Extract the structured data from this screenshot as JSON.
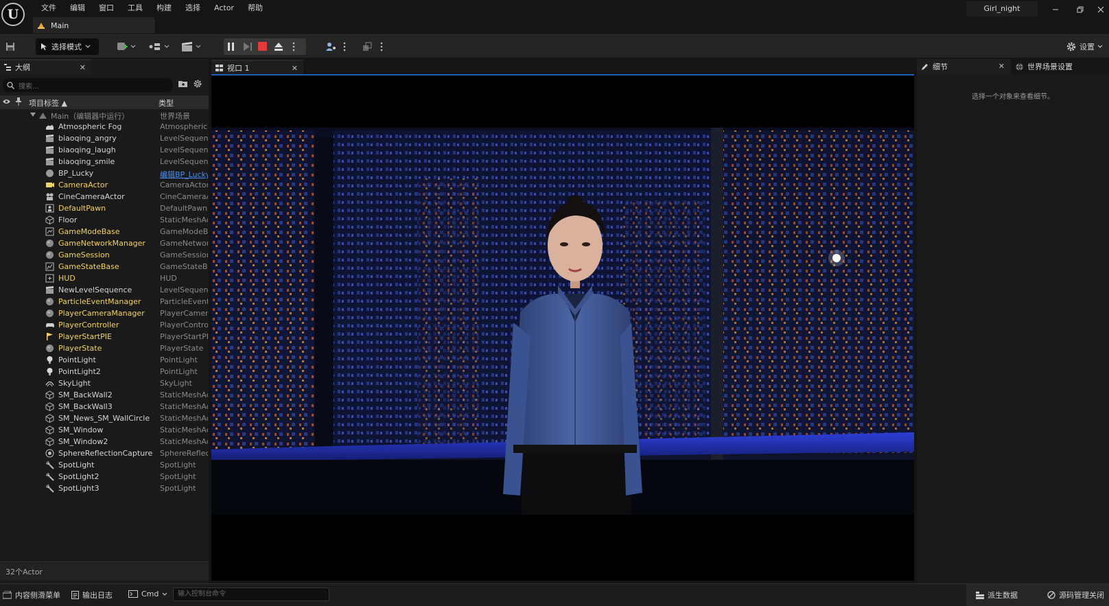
{
  "app": {
    "project_name": "Girl_night",
    "level_tab": "Main",
    "accent_color": "#1d5fb8",
    "menu": [
      "文件",
      "编辑",
      "窗口",
      "工具",
      "构建",
      "选择",
      "Actor",
      "帮助"
    ]
  },
  "toolbar": {
    "mode_label": "选择模式",
    "settings_label": "设置"
  },
  "outliner": {
    "tab_label": "大纲",
    "search_placeholder": "搜索...",
    "col_label": "项目标签 ▲",
    "col_type": "类型",
    "root": {
      "name": "Main（编辑器中运行）",
      "type": "世界场景"
    },
    "rows": [
      {
        "name": "Atmospheric Fog",
        "type": "AtmosphericFog",
        "icon": "fog-icon"
      },
      {
        "name": "biaoqing_angry",
        "type": "LevelSequence",
        "icon": "clapperboard-icon"
      },
      {
        "name": "biaoqing_laugh",
        "type": "LevelSequence",
        "icon": "clapperboard-icon"
      },
      {
        "name": "biaoqing_smile",
        "type": "LevelSequence",
        "icon": "clapperboard-icon"
      },
      {
        "name": "BP_Lucky",
        "type": "编辑BP_Lucky",
        "icon": "blueprint-sphere-icon"
      },
      {
        "name": "CameraActor",
        "type": "CameraActor",
        "icon": "camera-icon"
      },
      {
        "name": "CineCameraActor",
        "type": "CineCameraActor",
        "icon": "cine-camera-icon"
      },
      {
        "name": "DefaultPawn",
        "type": "DefaultPawn",
        "icon": "pawn-icon"
      },
      {
        "name": "Floor",
        "type": "StaticMeshActor",
        "icon": "static-mesh-icon"
      },
      {
        "name": "GameModeBase",
        "type": "GameModeBase",
        "icon": "game-mode-icon"
      },
      {
        "name": "GameNetworkManager",
        "type": "GameNetworkManager",
        "icon": "sphere-icon"
      },
      {
        "name": "GameSession",
        "type": "GameSession",
        "icon": "sphere-icon"
      },
      {
        "name": "GameStateBase",
        "type": "GameStateBase",
        "icon": "game-state-icon"
      },
      {
        "name": "HUD",
        "type": "HUD",
        "icon": "hud-icon"
      },
      {
        "name": "NewLevelSequence",
        "type": "LevelSequence",
        "icon": "clapperboard-icon"
      },
      {
        "name": "ParticleEventManager",
        "type": "ParticleEventManager",
        "icon": "sphere-icon"
      },
      {
        "name": "PlayerCameraManager",
        "type": "PlayerCameraManager",
        "icon": "sphere-icon"
      },
      {
        "name": "PlayerController",
        "type": "PlayerController",
        "icon": "gamepad-icon"
      },
      {
        "name": "PlayerStartPIE",
        "type": "PlayerStartPIE",
        "icon": "flag-icon"
      },
      {
        "name": "PlayerState",
        "type": "PlayerState",
        "icon": "sphere-icon"
      },
      {
        "name": "PointLight",
        "type": "PointLight",
        "icon": "bulb-icon"
      },
      {
        "name": "PointLight2",
        "type": "PointLight",
        "icon": "bulb-icon"
      },
      {
        "name": "SkyLight",
        "type": "SkyLight",
        "icon": "skylight-icon"
      },
      {
        "name": "SM_BackWall2",
        "type": "StaticMeshActor",
        "icon": "static-mesh-icon"
      },
      {
        "name": "SM_BackWall3",
        "type": "StaticMeshActor",
        "icon": "static-mesh-icon"
      },
      {
        "name": "SM_News_SM_WallCircle",
        "type": "StaticMeshActor",
        "icon": "static-mesh-icon"
      },
      {
        "name": "SM_Window",
        "type": "StaticMeshActor",
        "icon": "static-mesh-icon"
      },
      {
        "name": "SM_Window2",
        "type": "StaticMeshActor",
        "icon": "static-mesh-icon"
      },
      {
        "name": "SphereReflectionCapture",
        "type": "SphereReflectionCapture",
        "icon": "reflection-icon"
      },
      {
        "name": "SpotLight",
        "type": "SpotLight",
        "icon": "spotlight-icon"
      },
      {
        "name": "SpotLight2",
        "type": "SpotLight",
        "icon": "spotlight-icon"
      },
      {
        "name": "SpotLight3",
        "type": "SpotLight",
        "icon": "spotlight-icon"
      }
    ],
    "actor_count": "32个Actor"
  },
  "viewport": {
    "tab_label": "视口 1"
  },
  "details": {
    "tab_label": "细节",
    "world_tab_label": "世界场景设置",
    "empty_text": "选择一个对象来查看细节。"
  },
  "statusbar": {
    "content_drawer": "内容侧滑菜单",
    "output_log": "输出日志",
    "cmd_label": "Cmd",
    "console_placeholder": "输入控制台命令",
    "derived_data": "派生数据",
    "source_control": "源码管理关闭"
  }
}
